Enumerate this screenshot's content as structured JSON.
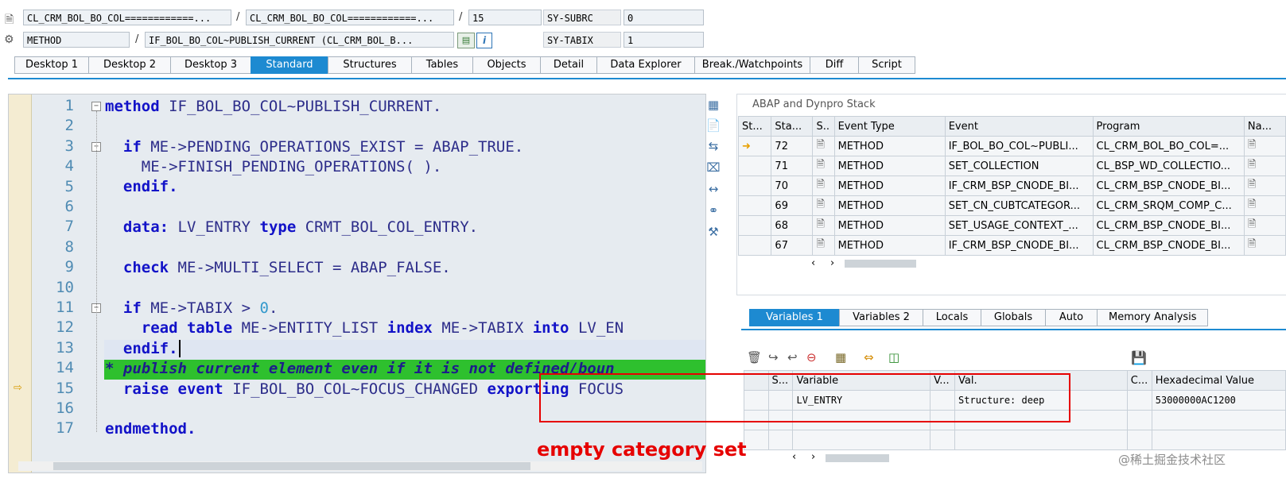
{
  "header": {
    "row1": {
      "field1": "CL_CRM_BOL_BO_COL============...",
      "field2": "CL_CRM_BOL_BO_COL============...",
      "field3": "15",
      "label": "SY-SUBRC",
      "value": "0"
    },
    "row2": {
      "field1": "METHOD",
      "field2": "IF_BOL_BO_COL~PUBLISH_CURRENT (CL_CRM_BOL_B...",
      "label": "SY-TABIX",
      "value": "1"
    },
    "slash": "/"
  },
  "tabs": [
    "Desktop 1",
    "Desktop 2",
    "Desktop 3",
    "Standard",
    "Structures",
    "Tables",
    "Objects",
    "Detail",
    "Data Explorer",
    "Break./Watchpoints",
    "Diff",
    "Script"
  ],
  "editor": {
    "line_numbers": [
      "1",
      "2",
      "3",
      "4",
      "5",
      "6",
      "7",
      "8",
      "9",
      "10",
      "11",
      "12",
      "13",
      "14",
      "15",
      "16",
      "17"
    ]
  },
  "stack": {
    "title": "ABAP and Dynpro Stack",
    "columns": [
      "St...",
      "Sta...",
      "S..",
      "Event Type",
      "Event",
      "Program",
      "Na..."
    ],
    "rows": [
      {
        "level": "72",
        "type": "METHOD",
        "event": "IF_BOL_BO_COL~PUBLI...",
        "program": "CL_CRM_BOL_BO_COL=..."
      },
      {
        "level": "71",
        "type": "METHOD",
        "event": "SET_COLLECTION",
        "program": "CL_BSP_WD_COLLECTIO..."
      },
      {
        "level": "70",
        "type": "METHOD",
        "event": "IF_CRM_BSP_CNODE_BI...",
        "program": "CL_CRM_BSP_CNODE_BI..."
      },
      {
        "level": "69",
        "type": "METHOD",
        "event": "SET_CN_CUBTCATEGOR...",
        "program": "CL_CRM_SRQM_COMP_C..."
      },
      {
        "level": "68",
        "type": "METHOD",
        "event": "SET_USAGE_CONTEXT_...",
        "program": "CL_CRM_BSP_CNODE_BI..."
      },
      {
        "level": "67",
        "type": "METHOD",
        "event": "IF_CRM_BSP_CNODE_BI...",
        "program": "CL_CRM_BSP_CNODE_BI..."
      }
    ]
  },
  "vartabs": [
    "Variables 1",
    "Variables 2",
    "Locals",
    "Globals",
    "Auto",
    "Memory Analysis"
  ],
  "variables": {
    "columns": [
      "S...",
      "Variable",
      "V...",
      "Val.",
      "C...",
      "Hexadecimal Value"
    ],
    "rows": [
      {
        "name": "LV_ENTRY",
        "value": "Structure: deep",
        "hex": "53000000AC1200"
      }
    ]
  },
  "annotation": "empty category set",
  "watermark": "@稀土掘金技术社区",
  "colors": {
    "accent": "#1d8ad1",
    "highlight": "#2ec02e",
    "annotation": "#e60000"
  }
}
